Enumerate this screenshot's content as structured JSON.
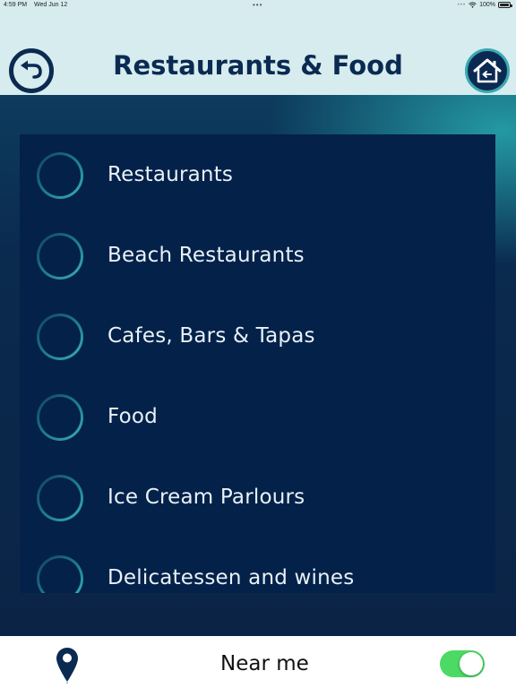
{
  "status_bar": {
    "time": "4:59 PM",
    "date": "Wed Jun 12",
    "battery": "100%"
  },
  "header": {
    "title": "Restaurants & Food",
    "back_icon": "back-arrow-icon",
    "home_icon": "home-icon"
  },
  "categories": [
    {
      "label": "Restaurants"
    },
    {
      "label": "Beach Restaurants"
    },
    {
      "label": "Cafes, Bars & Tapas"
    },
    {
      "label": "Food"
    },
    {
      "label": "Ice Cream Parlours"
    },
    {
      "label": "Delicatessen and wines"
    }
  ],
  "bottom_bar": {
    "near_me_label": "Near me",
    "near_me_enabled": true,
    "pin_icon": "location-pin-icon"
  },
  "colors": {
    "header_bg": "#d6ecee",
    "title": "#0b2a52",
    "panel_bg": "#04214a",
    "accent": "#3ab0bd",
    "toggle_on": "#4cd964"
  }
}
